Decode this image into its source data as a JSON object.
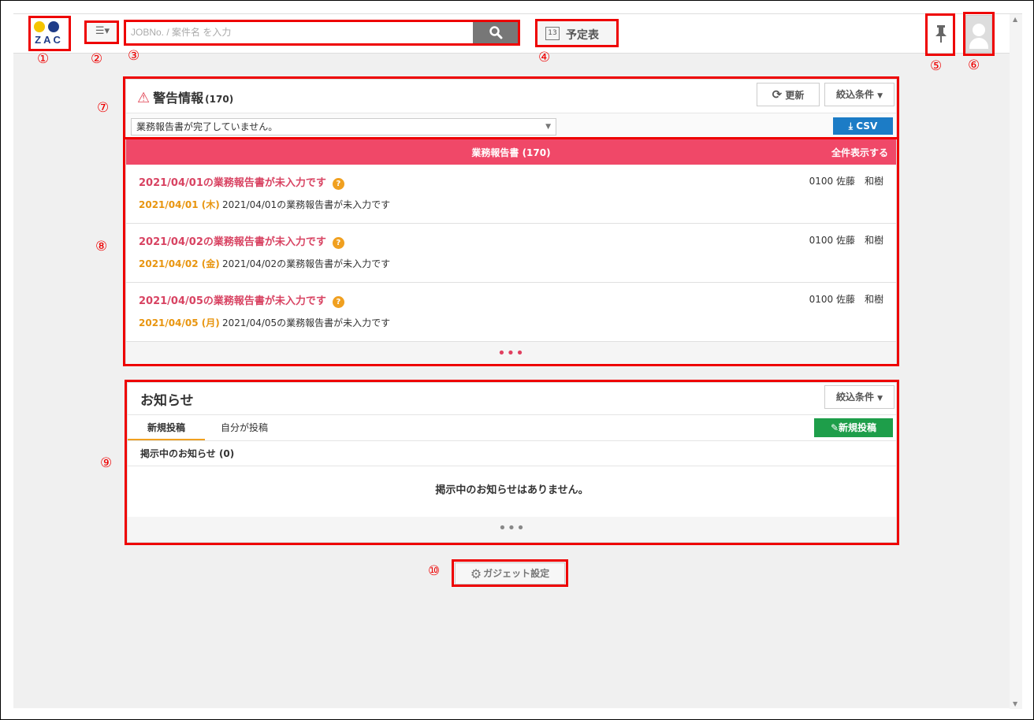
{
  "header": {
    "logo_text": "ZAC",
    "search_placeholder": "JOBNo. / 案件名 を入力",
    "schedule_label": "予定表",
    "calendar_day": "13"
  },
  "markers": [
    "①",
    "②",
    "③",
    "④",
    "⑤",
    "⑥",
    "⑦",
    "⑧",
    "⑨",
    "⑩"
  ],
  "warning": {
    "title": "警告情報",
    "count": "(170)",
    "refresh_label": "更新",
    "filter_label": "絞込条件",
    "selected_filter": "業務報告書が完了していません。",
    "csv_label": "CSV",
    "bar_title": "業務報告書 (170)",
    "bar_link": "全件表示する",
    "items": [
      {
        "title": "2021/04/01の業務報告書が未入力です",
        "user": "0100 佐藤　和樹",
        "date": "2021/04/01 (木)",
        "message": "2021/04/01の業務報告書が未入力です"
      },
      {
        "title": "2021/04/02の業務報告書が未入力です",
        "user": "0100 佐藤　和樹",
        "date": "2021/04/02 (金)",
        "message": "2021/04/02の業務報告書が未入力です"
      },
      {
        "title": "2021/04/05の業務報告書が未入力です",
        "user": "0100 佐藤　和樹",
        "date": "2021/04/05 (月)",
        "message": "2021/04/05の業務報告書が未入力です"
      }
    ],
    "more": "•••"
  },
  "news": {
    "title": "お知らせ",
    "filter_label": "絞込条件",
    "tab_new": "新規投稿",
    "tab_mine": "自分が投稿",
    "new_post_label": "新規投稿",
    "subhead": "掲示中のお知らせ (0)",
    "empty_message": "掲示中のお知らせはありません。",
    "more": "•••"
  },
  "gadget_label": "ガジェット設定",
  "colors": {
    "alert_bar": "#f04868",
    "alert_title": "#d84362",
    "date": "#e8950f",
    "csv": "#1c7cc6",
    "new_post": "#1e9e4a",
    "annotation": "#ee0000"
  }
}
